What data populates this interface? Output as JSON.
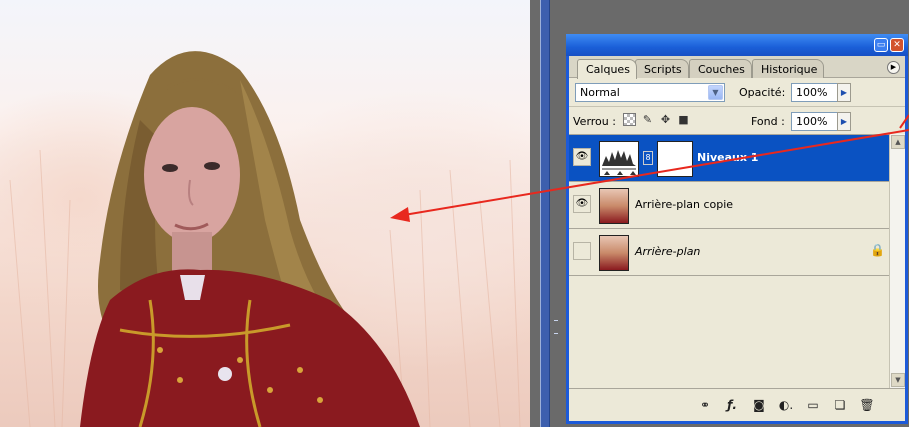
{
  "palette": {
    "tabs": [
      "Calques",
      "Scripts",
      "Couches",
      "Historique"
    ],
    "blend_mode": "Normal",
    "opacity_label": "Opacité:",
    "opacity_value": "100%",
    "lock_label": "Verrou :",
    "fill_label": "Fond :",
    "fill_value": "100%",
    "layers": [
      {
        "name": "Niveaux 1",
        "visible": true,
        "selected": true,
        "type": "adjustment"
      },
      {
        "name": "Arrière-plan copie",
        "visible": true,
        "selected": false,
        "type": "image"
      },
      {
        "name": "Arrière-plan",
        "visible": false,
        "selected": false,
        "type": "image",
        "locked": true
      }
    ]
  },
  "icons": {
    "visibility": "eye-icon",
    "lock": "lock-icon",
    "link": "link-icon",
    "style": "layer-style-icon",
    "mask": "mask-icon",
    "adjustment": "adjustment-icon",
    "group": "folder-icon",
    "new_layer": "new-layer-icon",
    "delete": "trash-icon"
  },
  "colors": {
    "selection": "#0a52c2",
    "titlebar": "#1a5fd8",
    "annotation_arrow": "#e8281e"
  }
}
